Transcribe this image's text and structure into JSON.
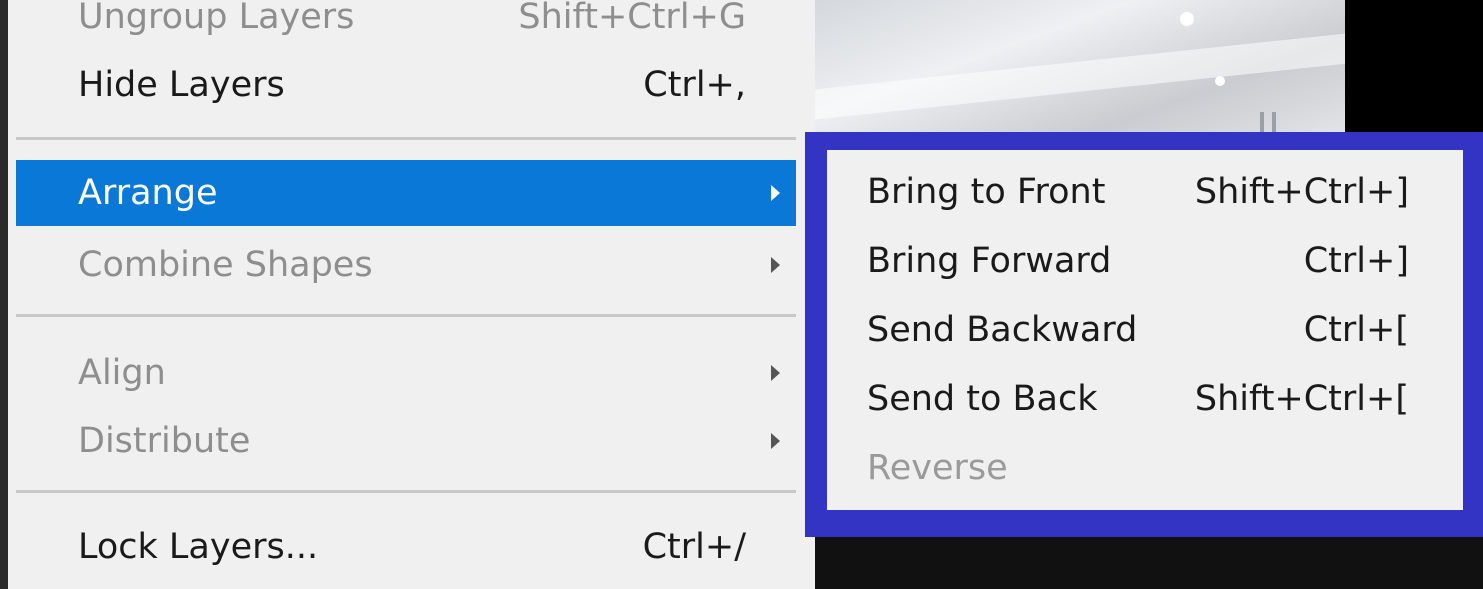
{
  "main_menu": {
    "items": [
      {
        "label": "Ungroup Layers",
        "shortcut": "Shift+Ctrl+G"
      },
      {
        "label": "Hide Layers",
        "shortcut": "Ctrl+,"
      },
      {
        "label": "Arrange",
        "shortcut": ""
      },
      {
        "label": "Combine Shapes",
        "shortcut": ""
      },
      {
        "label": "Align",
        "shortcut": ""
      },
      {
        "label": "Distribute",
        "shortcut": ""
      },
      {
        "label": "Lock Layers...",
        "shortcut": "Ctrl+/"
      }
    ]
  },
  "arrange_submenu": {
    "items": [
      {
        "label": "Bring to Front",
        "shortcut": "Shift+Ctrl+]"
      },
      {
        "label": "Bring Forward",
        "shortcut": "Ctrl+]"
      },
      {
        "label": "Send Backward",
        "shortcut": "Ctrl+["
      },
      {
        "label": "Send to Back",
        "shortcut": "Shift+Ctrl+["
      },
      {
        "label": "Reverse",
        "shortcut": ""
      }
    ]
  },
  "colors": {
    "highlight": "#0a78d7",
    "submenu_outline": "#3333c4",
    "menu_background": "#f0f0f0",
    "disabled_text": "#8e8e8e"
  }
}
